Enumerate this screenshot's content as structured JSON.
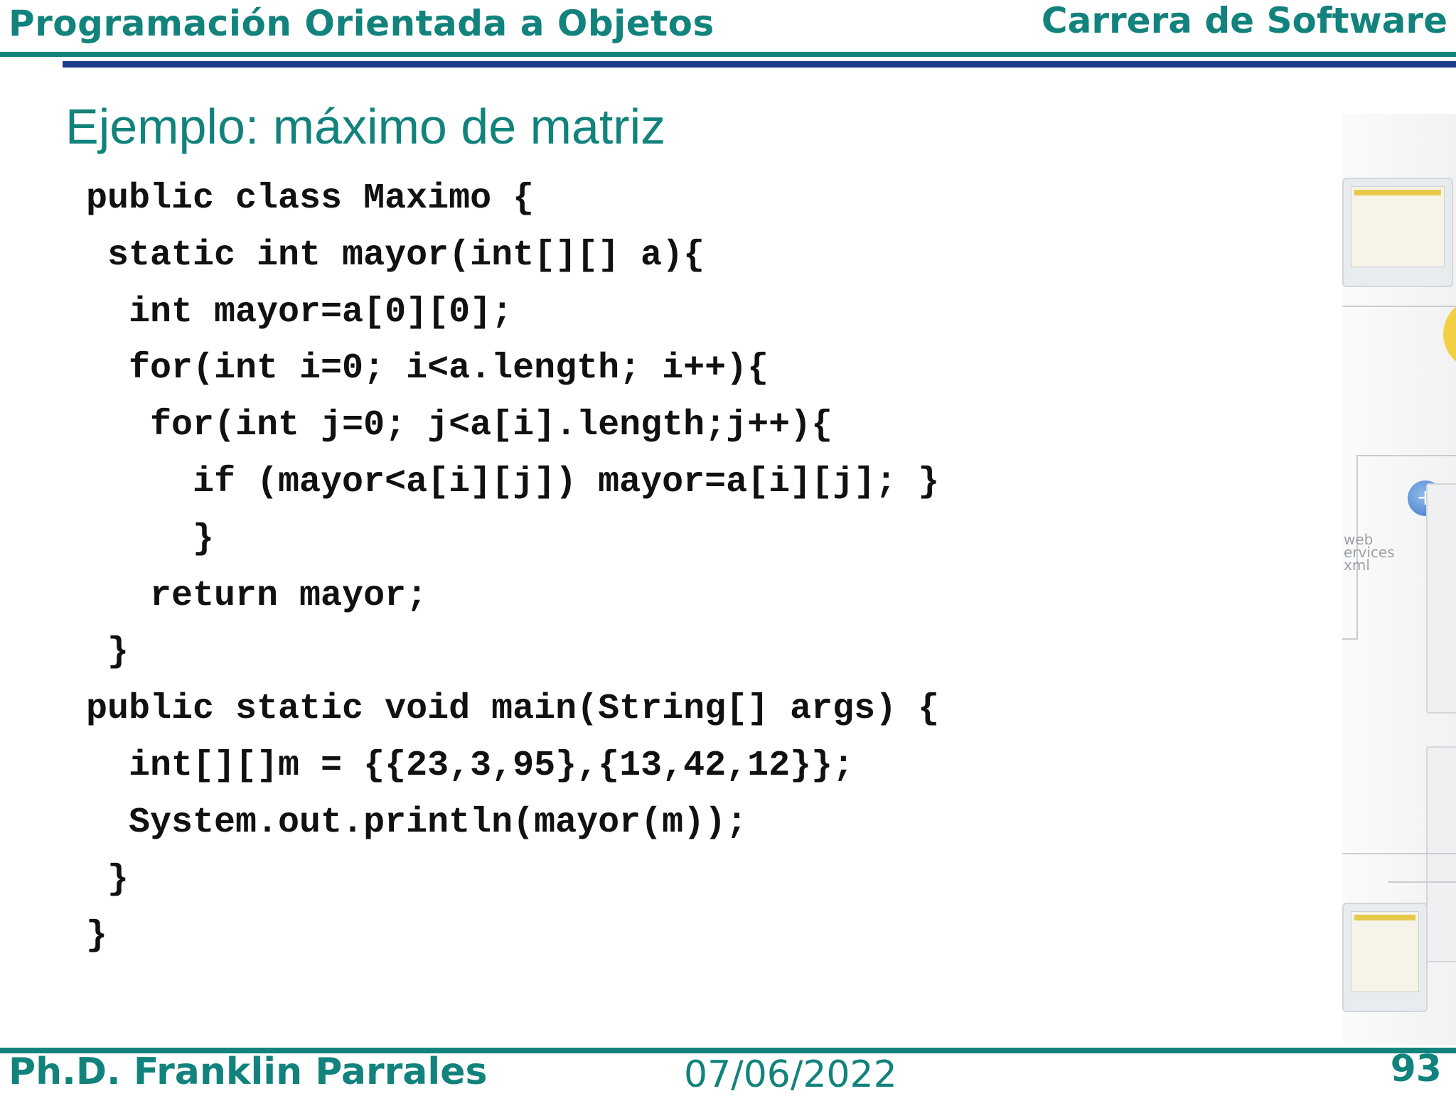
{
  "header": {
    "course": "Programación Orientada a Objetos",
    "program": "Carrera de Software"
  },
  "slide": {
    "title": "Ejemplo: máximo de matriz",
    "code_lines": [
      "public class Maximo {",
      " static int mayor(int[][] a){",
      "  int mayor=a[0][0];",
      "  for(int i=0; i<a.length; i++){",
      "   for(int j=0; j<a[i].length;j++){",
      "     if (mayor<a[i][j]) mayor=a[i][j]; }",
      "     }",
      "   return mayor;",
      " }",
      "public static void main(String[] args) {",
      "  int[][]m = {{23,3,95},{13,42,12}};",
      "  System.out.println(mayor(m));",
      " }",
      "}"
    ]
  },
  "decoration": {
    "label": "web\nervices\nxml"
  },
  "footer": {
    "author": "Ph.D. Franklin Parrales",
    "date": "07/06/2022",
    "page_number": "93"
  },
  "colors": {
    "accent": "#12837c",
    "secondary_rule": "#1d3d8a",
    "code_text": "#111111"
  }
}
